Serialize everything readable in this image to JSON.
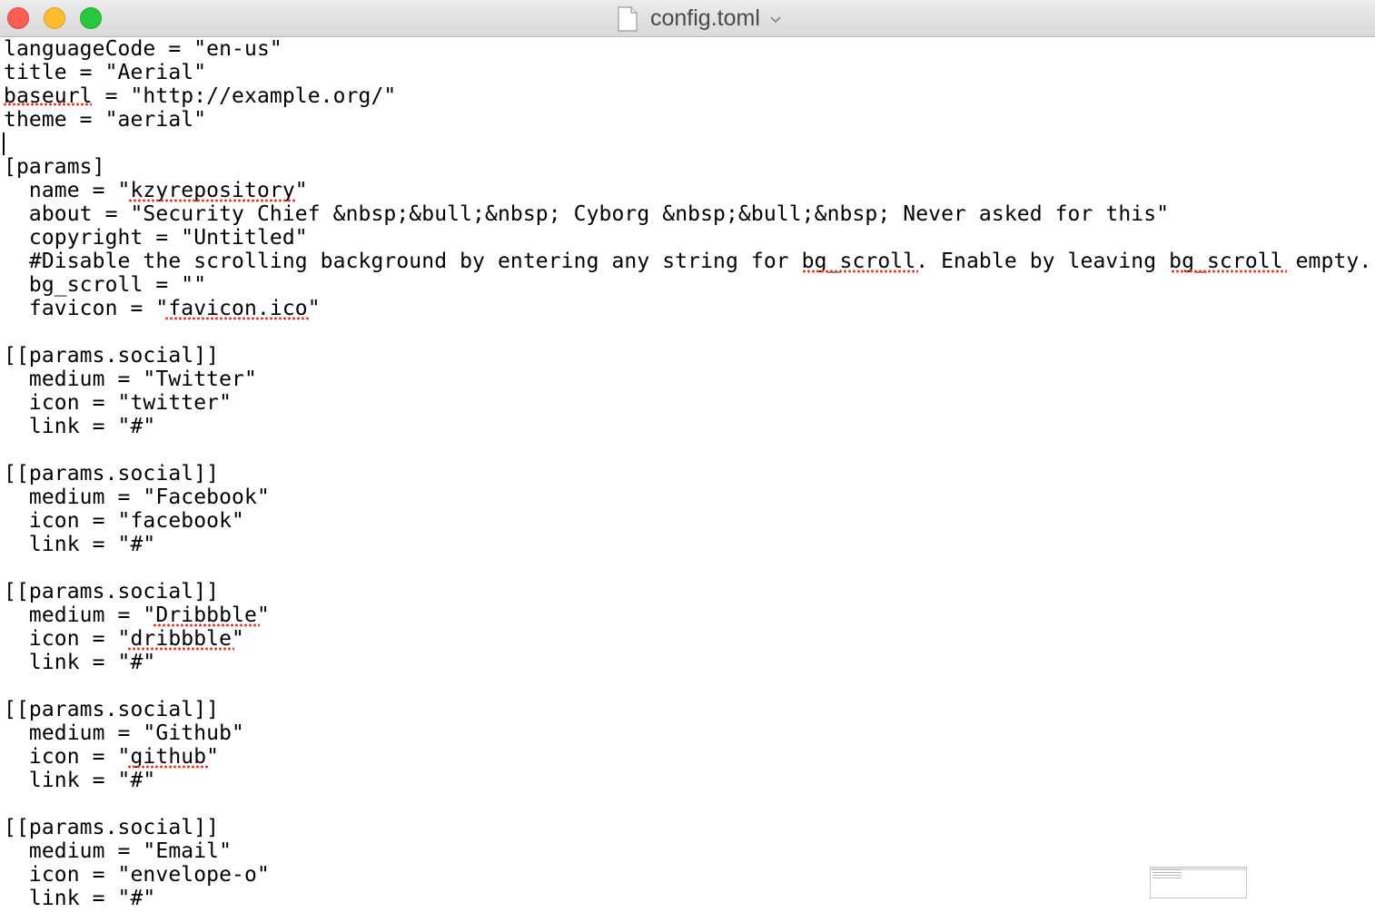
{
  "window": {
    "title": "config.toml"
  },
  "editor": {
    "lines": [
      "languageCode = \"en-us\"",
      "title = \"Aerial\"",
      "baseurl = \"http://example.org/\"",
      "theme = \"aerial\"",
      "",
      "[params]",
      "  name = \"kzyrepository\"",
      "  about = \"Security Chief &nbsp;&bull;&nbsp; Cyborg &nbsp;&bull;&nbsp; Never asked for this\"",
      "  copyright = \"Untitled\"",
      "  #Disable the scrolling background by entering any string for bg_scroll. Enable by leaving bg_scroll empty.",
      "  bg_scroll = \"\"",
      "  favicon = \"favicon.ico\"",
      "",
      "[[params.social]]",
      "  medium = \"Twitter\"",
      "  icon = \"twitter\"",
      "  link = \"#\"",
      "",
      "[[params.social]]",
      "  medium = \"Facebook\"",
      "  icon = \"facebook\"",
      "  link = \"#\"",
      "",
      "[[params.social]]",
      "  medium = \"Dribbble\"",
      "  icon = \"dribbble\"",
      "  link = \"#\"",
      "",
      "[[params.social]]",
      "  medium = \"Github\"",
      "  icon = \"github\"",
      "  link = \"#\"",
      "",
      "[[params.social]]",
      "  medium = \"Email\"",
      "  icon = \"envelope-o\"",
      "  link = \"#\""
    ],
    "misspelled_words": [
      "baseurl",
      "kzyrepository",
      "bg_scroll",
      "bg_scroll",
      "favicon.ico",
      "Dribbble",
      "dribbble",
      "github"
    ]
  },
  "icons": {
    "document": "document-icon",
    "chevron": "chevron-down-icon"
  },
  "colors": {
    "close": "#fd5f57",
    "minimize": "#febd2e",
    "zoom": "#27c840",
    "spellcheck": "#e53a2d"
  }
}
